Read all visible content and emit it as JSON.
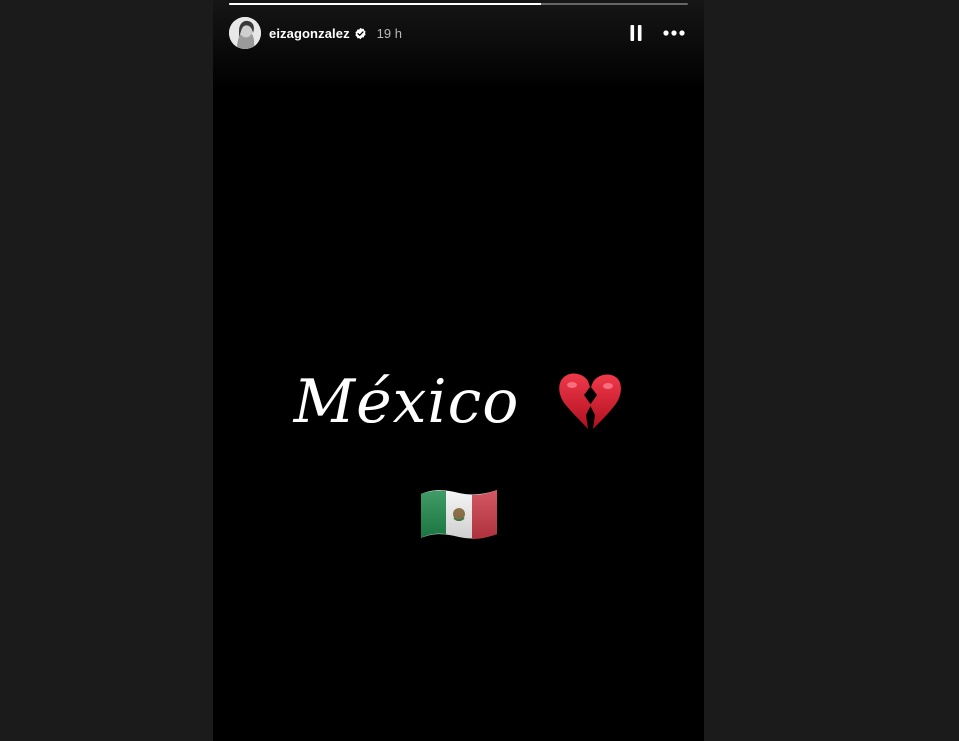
{
  "story": {
    "username": "eizagonzalez",
    "verified": true,
    "timestamp": "19 h",
    "progress": 0.68,
    "caption": "México",
    "emojis": [
      "broken-heart",
      "mexico-flag"
    ]
  },
  "controls": {
    "pause_icon": "pause-icon",
    "more_icon": "more-options-icon"
  },
  "colors": {
    "background": "#1b1b1b",
    "story_background": "#000000",
    "verified_badge": "#ffffff",
    "flag_green": "#1f8a4c",
    "flag_white": "#f4f4f4",
    "flag_red": "#cc3b48",
    "heart_red": "#d4182b"
  }
}
